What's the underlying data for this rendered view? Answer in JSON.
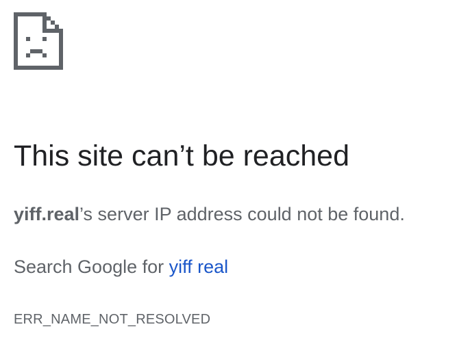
{
  "icon": {
    "name": "sad-page-icon",
    "color": "#5f6368"
  },
  "heading": "This site can’t be reached",
  "detail": {
    "host": "yiff.real",
    "message": "’s server IP address could not be found."
  },
  "suggestion": {
    "prefix": "Search Google for ",
    "link_text": "yiff real"
  },
  "error_code": "ERR_NAME_NOT_RESOLVED",
  "colors": {
    "heading": "#202124",
    "body_text": "#5f6368",
    "link": "#1a56c9",
    "background": "#ffffff"
  }
}
